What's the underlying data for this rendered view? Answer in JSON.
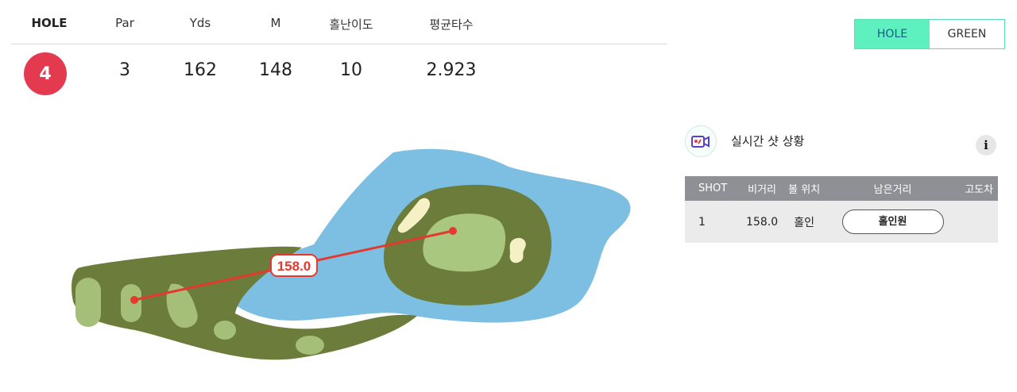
{
  "stats": {
    "headers": {
      "hole": "HOLE",
      "par": "Par",
      "yds": "Yds",
      "m": "M",
      "difficulty": "홀난이도",
      "avg_score": "평균타수"
    },
    "values": {
      "hole": "4",
      "par": "3",
      "yds": "162",
      "m": "148",
      "difficulty": "10",
      "avg_score": "2.923"
    }
  },
  "toggle": {
    "options": [
      "HOLE",
      "GREEN"
    ],
    "selected": "HOLE"
  },
  "map": {
    "shot_distance_label": "158.0",
    "colors": {
      "water": "#7dbfe3",
      "rough": "#6c7d3b",
      "fairway": "#a5bf78",
      "green": "#a9c77e",
      "bunker": "#f6f1c5",
      "shot_line": "#e23a2e"
    }
  },
  "realtime": {
    "title": "실시간 샷 상황",
    "icon": "camera-icon",
    "info_icon": "info-icon",
    "columns": [
      "SHOT",
      "비거리",
      "볼 위치",
      "남은거리",
      "고도차"
    ],
    "rows": [
      {
        "shot": "1",
        "distance": "158.0",
        "position": "홀인",
        "remaining": "홀인원",
        "elevation": ""
      }
    ]
  }
}
